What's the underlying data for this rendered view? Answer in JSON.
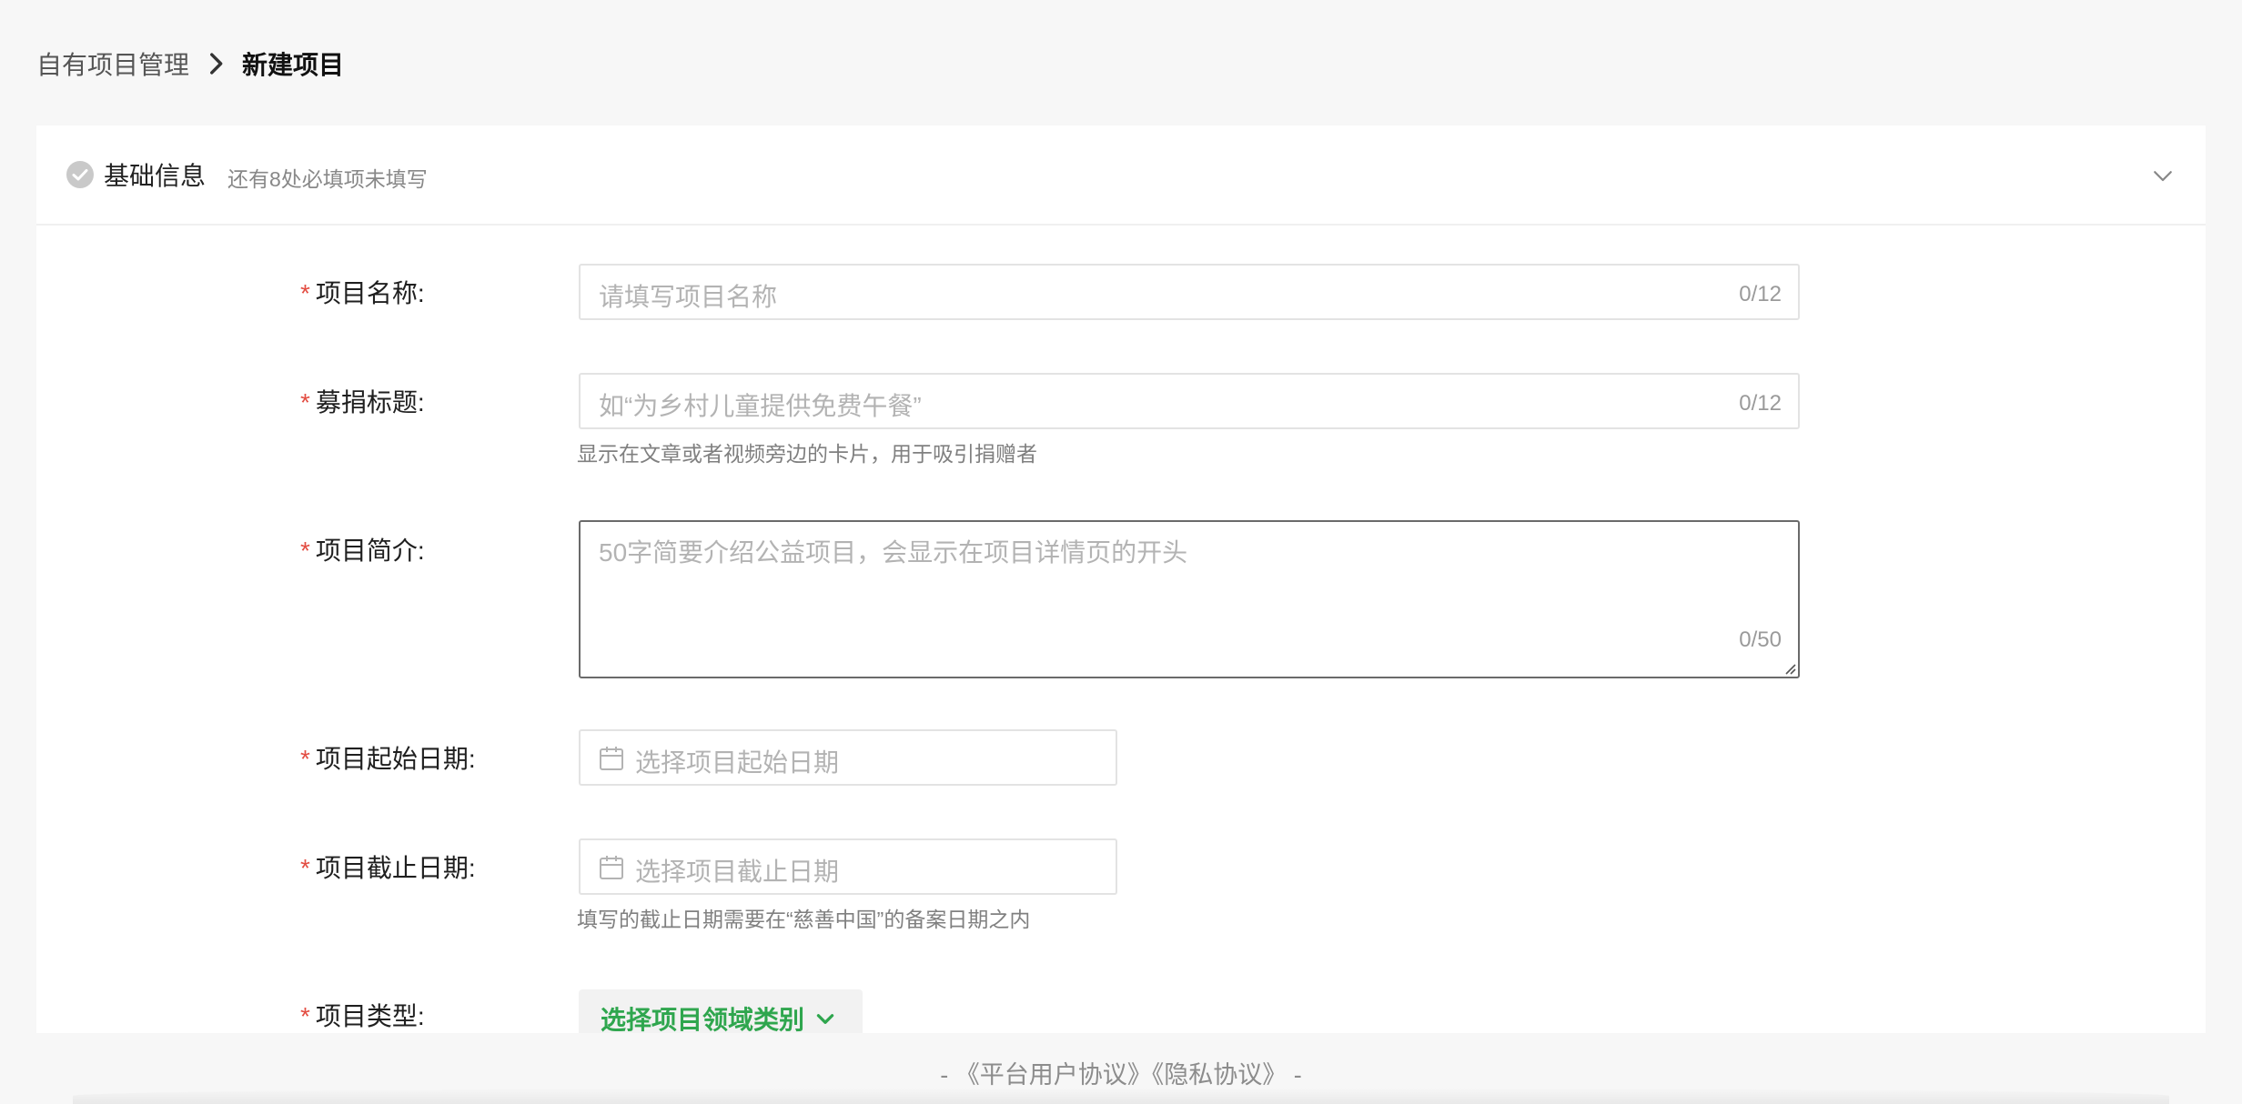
{
  "breadcrumb": {
    "parent": "自有项目管理",
    "current": "新建项目"
  },
  "section": {
    "title": "基础信息",
    "hint": "还有8处必填项未填写",
    "status_icon": "check-circle-icon",
    "collapse_icon": "chevron-down-icon"
  },
  "fields": {
    "name": {
      "required_mark": "*",
      "label": "项目名称:",
      "placeholder": "请填写项目名称",
      "counter": "0/12"
    },
    "fundraise_title": {
      "required_mark": "*",
      "label": "募捐标题:",
      "placeholder": "如“为乡村儿童提供免费午餐”",
      "counter": "0/12",
      "help": "显示在文章或者视频旁边的卡片，用于吸引捐赠者"
    },
    "intro": {
      "required_mark": "*",
      "label": "项目简介:",
      "placeholder": "50字简要介绍公益项目，会显示在项目详情页的开头",
      "counter": "0/50"
    },
    "start_date": {
      "required_mark": "*",
      "label": "项目起始日期:",
      "placeholder": "选择项目起始日期",
      "icon": "calendar-icon"
    },
    "end_date": {
      "required_mark": "*",
      "label": "项目截止日期:",
      "placeholder": "选择项目截止日期",
      "icon": "calendar-icon",
      "help": "填写的截止日期需要在“慈善中国”的备案日期之内"
    },
    "type": {
      "required_mark": "*",
      "label": "项目类型:",
      "button_label": "选择项目领域类别",
      "button_icon": "chevron-down-icon"
    }
  },
  "footer": {
    "prefix": "-",
    "platform_agreement": "《平台用户协议》",
    "privacy_agreement": "《隐私协议》",
    "suffix": "-"
  },
  "colors": {
    "background": "#f7f7f7",
    "card": "#ffffff",
    "required": "#e34d42",
    "accent_green": "#2fa64e",
    "placeholder": "#b3b3b3",
    "hint": "#888888"
  }
}
